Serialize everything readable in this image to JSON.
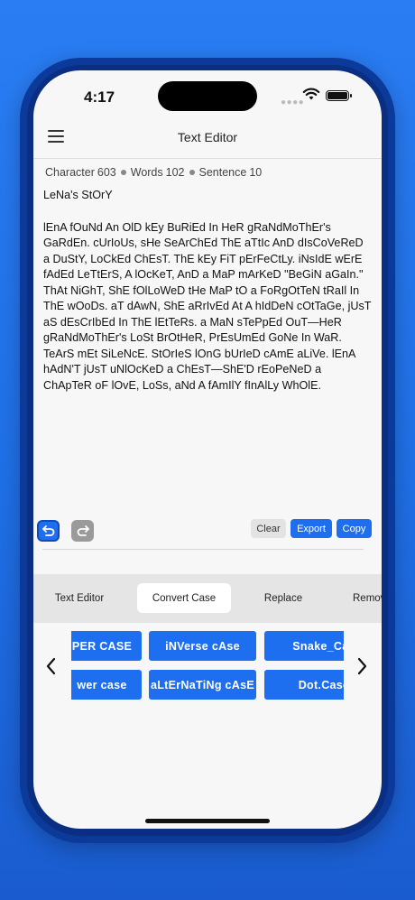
{
  "status_bar": {
    "time": "4:17"
  },
  "nav": {
    "title": "Text Editor"
  },
  "stats": {
    "character_label": "Character",
    "character_count": "603",
    "words_label": "Words",
    "words_count": "102",
    "sentence_label": "Sentence",
    "sentence_count": "10"
  },
  "editor": {
    "title": "LeNa's StOrY",
    "body": "lEnA fOuNd An OlD kEy BuRiEd In HeR gRaNdMoThEr's GaRdEn. cUrIoUs, sHe SeArChEd ThE aTtIc AnD dIsCoVeReD a DuStY, LoCkEd ChEsT. ThE kEy FiT pErFeCtLy. iNsIdE wErE fAdEd LeTtErS, A lOcKeT, AnD a MaP mArKeD \"BeGiN aGaIn.\" ThAt NiGhT, ShE fOlLoWeD tHe MaP tO a FoRgOtTeN tRaIl In ThE wOoDs. aT dAwN, ShE aRrIvEd At A hIdDeN cOtTaGe, jUsT aS dEsCrIbEd In ThE lEtTeRs. a MaN sTePpEd OuT—HeR gRaNdMoThEr's LoSt BrOtHeR, PrEsUmEd GoNe In WaR. TeArS mEt SiLeNcE. StOrIeS lOnG bUrIeD cAmE aLiVe. lEnA hAdN'T jUsT uNlOcKeD a ChEsT—ShE'D rEoPeNeD a ChApTeR oF lOvE, LoSs, aNd A fAmIlY fInAlLy WhOlE."
  },
  "actions": {
    "clear": "Clear",
    "export": "Export",
    "copy": "Copy"
  },
  "tabs": [
    {
      "label": "Text Editor",
      "active": false
    },
    {
      "label": "Convert Case",
      "active": true
    },
    {
      "label": "Replace",
      "active": false
    },
    {
      "label": "Remov",
      "active": false
    }
  ],
  "case_buttons": {
    "row1": [
      "PER CASE",
      "iNVerse cAse",
      "Snake_Cas"
    ],
    "row2": [
      "wer case",
      "aLtErNaTiNg cAsE",
      "Dot.Case"
    ]
  },
  "colors": {
    "accent": "#1e6ff0",
    "background_gradient_top": "#2a7df3",
    "frame": "#0c3a9a"
  },
  "icons": {
    "menu": "hamburger-menu-icon",
    "undo": "undo-icon",
    "redo": "redo-icon",
    "prev": "chevron-left-icon",
    "next": "chevron-right-icon"
  }
}
